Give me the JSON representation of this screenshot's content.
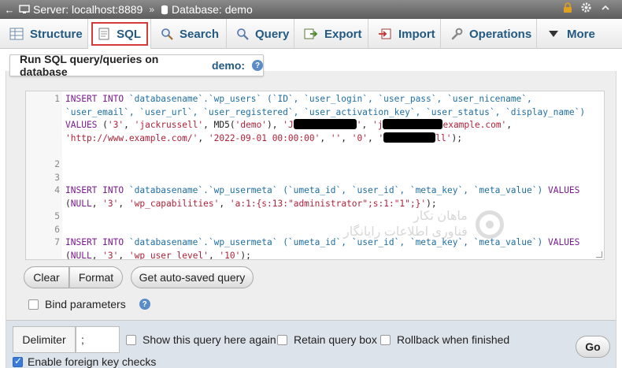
{
  "breadcrumb": {
    "server": "Server: localhost:8889",
    "separator": "»",
    "database": "Database: demo"
  },
  "tabs": [
    {
      "label": "Structure",
      "icon": "structure-icon"
    },
    {
      "label": "SQL",
      "icon": "sql-icon",
      "active": true
    },
    {
      "label": "Search",
      "icon": "search-icon"
    },
    {
      "label": "Query",
      "icon": "query-icon"
    },
    {
      "label": "Export",
      "icon": "export-icon"
    },
    {
      "label": "Import",
      "icon": "import-icon"
    },
    {
      "label": "Operations",
      "icon": "wrench-icon"
    },
    {
      "label": "More",
      "icon": "chevron-down-icon"
    }
  ],
  "header": {
    "prefix": "Run SQL query/queries on database",
    "database": "demo:"
  },
  "editor": {
    "line_numbers": [
      "1",
      "2",
      "3",
      "4",
      "5",
      "6",
      "7"
    ],
    "l1a_kw": "INSERT INTO",
    "l1a_table": "`databasename`.`wp_users`",
    "l1a_cols": "(`ID`, `user_login`, `user_pass`, `user_nicename`,",
    "l1b_cols": "`user_email`, `user_url`, `user_registered`, `user_activation_key`, `user_status`, `display_name`)",
    "l1c_kw": "VALUES",
    "l1c_v1": "'3'",
    "l1c_v2": "'jackrussell'",
    "l1c_fn": "MD5",
    "l1c_v3": "'demo'",
    "l1c_v4a": "'J",
    "l1c_v5a": "'j",
    "l1c_v5b": "example.com'",
    "l1d_v6": "'http://www.example.com/'",
    "l1d_v7": "'2022-09-01 00:00:00'",
    "l1d_v8": "''",
    "l1d_v9": "'0'",
    "l1d_v10b": "ll'",
    "l4a_kw": "INSERT INTO",
    "l4a_table": "`databasename`.`wp_usermeta`",
    "l4a_cols": "(`umeta_id`, `user_id`, `meta_key`, `meta_value`)",
    "l4a_values": "VALUES",
    "l4b_null": "NULL",
    "l4b_v1": "'3'",
    "l4b_v2": "'wp_capabilities'",
    "l4b_v3": "'a:1:{s:13:\"administrator\";s:1:\"1\";}'",
    "l7a_kw": "INSERT INTO",
    "l7a_table": "`databasename`.`wp_usermeta`",
    "l7a_cols": "(`umeta_id`, `user_id`, `meta_key`, `meta_value`)",
    "l7a_values": "VALUES",
    "l7b_null": "NULL",
    "l7b_v1": "'3'",
    "l7b_v2": "'wp_user_level'",
    "l7b_v3": "'10'"
  },
  "watermark": {
    "line1": "ماهان تکار",
    "line2": "فناوری اطلاعات رایانگار"
  },
  "buttons": {
    "clear": "Clear",
    "format": "Format",
    "autosave": "Get auto-saved query",
    "go": "Go"
  },
  "bind_parameters": {
    "label": "Bind parameters",
    "checked": false
  },
  "options": {
    "delimiter_label": "Delimiter",
    "delimiter_value": ";",
    "show_query_again": "Show this query here again",
    "retain_query_box": "Retain query box",
    "rollback": "Rollback when finished",
    "foreign_key_checks": "Enable foreign key checks",
    "foreign_key_checked": true
  },
  "colors": {
    "link": "#235a81",
    "active_tab_outline": "#d43b3b",
    "sql_keyword": "#7a1a8e",
    "sql_identifier": "#1f6fa3",
    "sql_string": "#b0223a"
  }
}
